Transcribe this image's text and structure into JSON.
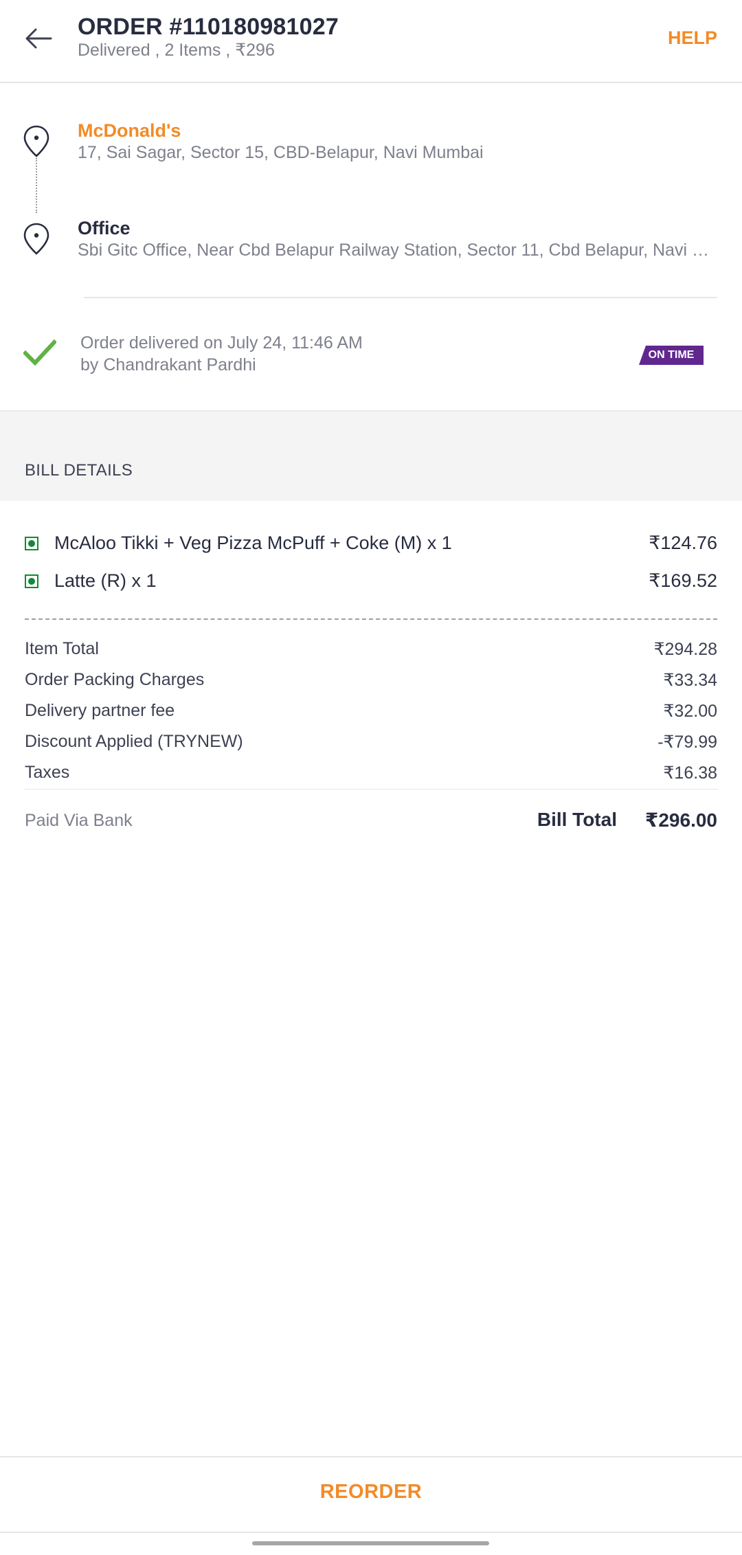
{
  "header": {
    "title": "ORDER #110180981027",
    "subtitle": "Delivered , 2 Items , ₹296",
    "help_label": "HELP"
  },
  "route": {
    "restaurant": {
      "name": "McDonald's",
      "address": "17, Sai Sagar, Sector 15, CBD-Belapur, Navi Mumbai"
    },
    "destination": {
      "name": "Office",
      "address": "Sbi Gitc Office, Near Cbd Belapur Railway Station, Sector 11, Cbd Belapur, Navi Mumbai"
    }
  },
  "delivery": {
    "line1": "Order delivered on July 24, 11:46 AM",
    "line2": "by Chandrakant Pardhi",
    "badge": "ON TIME"
  },
  "bill": {
    "heading": "BILL DETAILS",
    "items": [
      {
        "name": "McAloo Tikki + Veg Pizza McPuff + Coke (M) x 1",
        "price": "₹124.76"
      },
      {
        "name": "Latte (R) x 1",
        "price": "₹169.52"
      }
    ],
    "charges": [
      {
        "label": "Item Total",
        "value": "₹294.28"
      },
      {
        "label": "Order Packing Charges",
        "value": "₹33.34"
      },
      {
        "label": "Delivery partner fee",
        "value": "₹32.00"
      },
      {
        "label": "Discount Applied (TRYNEW)",
        "value": "-₹79.99"
      },
      {
        "label": "Taxes",
        "value": "₹16.38"
      }
    ],
    "paid_via": "Paid Via Bank",
    "total_label": "Bill Total",
    "total_value": "₹296.00"
  },
  "footer": {
    "reorder_label": "REORDER"
  },
  "colors": {
    "accent": "#f28b27",
    "ontime_badge": "#60278f",
    "veg": "#0f8a36",
    "check": "#60b246"
  },
  "icons": [
    "back-arrow-icon",
    "location-pin-icon",
    "check-icon",
    "veg-icon"
  ]
}
